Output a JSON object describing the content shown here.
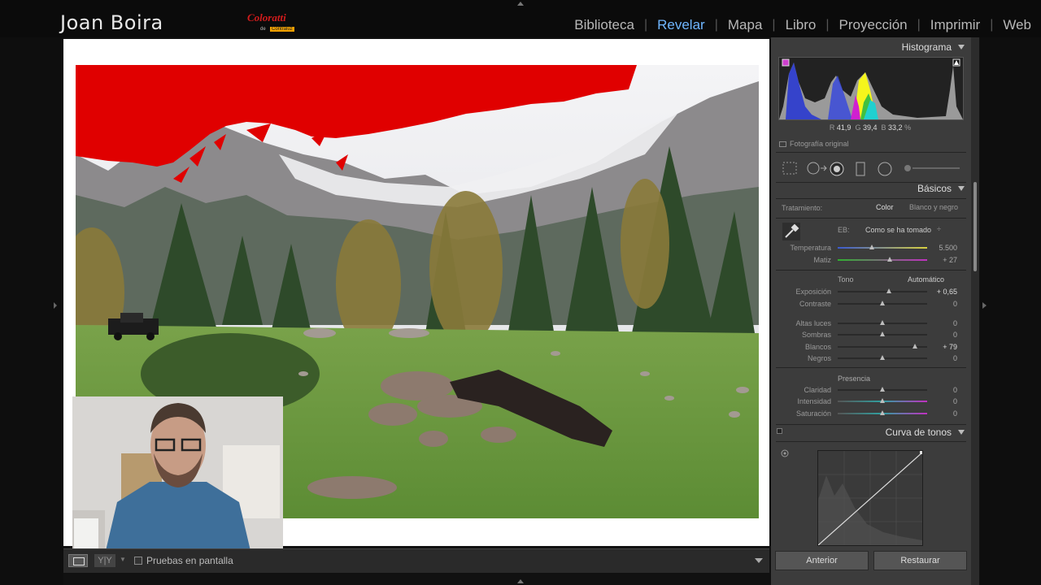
{
  "header": {
    "brand": "Joan Boira",
    "logo_top": "Coloratti",
    "logo_de": "de",
    "logo_brand": "Contraluz",
    "modules": [
      "Biblioteca",
      "Revelar",
      "Mapa",
      "Libro",
      "Proyección",
      "Imprimir",
      "Web"
    ],
    "active_module": "Revelar"
  },
  "toolbar": {
    "view_icon": "loupe-view-icon",
    "compare_label": "Y|Y",
    "soft_proof_label": "Pruebas en pantalla"
  },
  "histogram": {
    "title": "Histograma",
    "r_label": "R",
    "r_value": "41,9",
    "g_label": "G",
    "g_value": "39,4",
    "b_label": "B",
    "b_value": "33,2",
    "unit": "%",
    "original_photo_label": "Fotografía original"
  },
  "basics": {
    "title": "Básicos",
    "treatment_label": "Tratamiento:",
    "treatment_color": "Color",
    "treatment_bw": "Blanco y negro",
    "wb_label": "EB:",
    "wb_value": "Como se ha tomado",
    "temperature_label": "Temperatura",
    "temperature_value": "5.500",
    "tint_label": "Matiz",
    "tint_value": "+ 27",
    "tone_label": "Tono",
    "auto_label": "Automático",
    "exposure_label": "Exposición",
    "exposure_value": "+ 0,65",
    "contrast_label": "Contraste",
    "contrast_value": "0",
    "highlights_label": "Altas luces",
    "highlights_value": "0",
    "shadows_label": "Sombras",
    "shadows_value": "0",
    "whites_label": "Blancos",
    "whites_value": "+ 79",
    "blacks_label": "Negros",
    "blacks_value": "0",
    "presence_label": "Presencia",
    "clarity_label": "Claridad",
    "clarity_value": "0",
    "vibrance_label": "Intensidad",
    "vibrance_value": "0",
    "saturation_label": "Saturación",
    "saturation_value": "0",
    "slider_levels": {
      "temperature": 0.38,
      "tint": 0.58,
      "exposure": 0.57,
      "contrast": 0.5,
      "highlights": 0.5,
      "shadows": 0.5,
      "whites": 0.86,
      "blacks": 0.5,
      "clarity": 0.5,
      "vibrance": 0.5,
      "saturation": 0.5
    }
  },
  "tone_curve": {
    "title": "Curva de tonos"
  },
  "buttons": {
    "previous": "Anterior",
    "reset": "Restaurar"
  },
  "colors": {
    "accent": "#6fb6ff",
    "clipping": "#e00000",
    "panel_bg": "#3c3c3c"
  }
}
